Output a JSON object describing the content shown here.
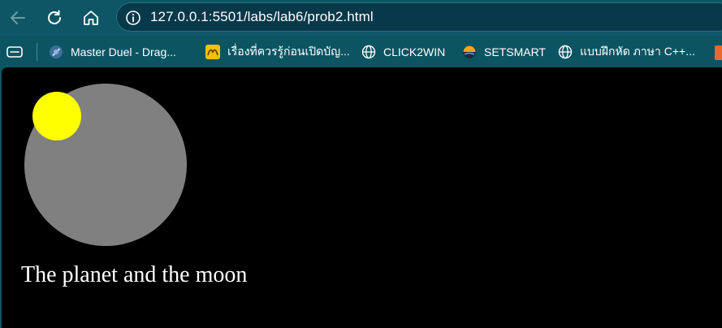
{
  "browser": {
    "url": "127.0.0.1:5501/labs/lab6/prob2.html",
    "nav": {
      "back_icon": "arrow-left-icon",
      "reload_icon": "reload-icon",
      "home_icon": "home-icon",
      "info_icon": "info-icon"
    },
    "bookmarks": [
      {
        "label": "Master Duel - Drag...",
        "icon": "game-favicon"
      },
      {
        "label": "เรื่องที่ควรรู้ก่อนเปิดบัญ...",
        "icon": "bank-favicon"
      },
      {
        "label": "CLICK2WIN",
        "icon": "globe-icon"
      },
      {
        "label": "SETSMART",
        "icon": "setsmart-favicon"
      },
      {
        "label": "แบบฝึกหัด ภาษา C++...",
        "icon": "globe-icon"
      }
    ]
  },
  "page": {
    "background": "#000000",
    "planet_color": "#808080",
    "moon_color": "#ffff00",
    "caption": "The planet and the moon"
  }
}
